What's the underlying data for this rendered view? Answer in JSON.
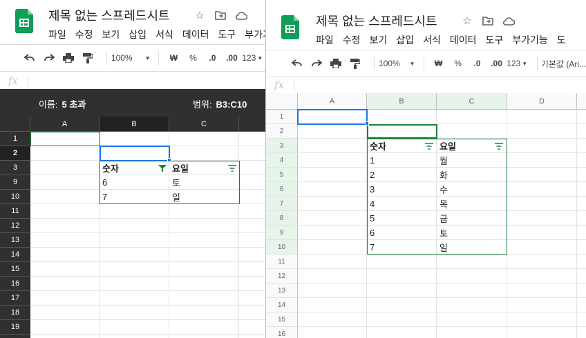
{
  "doc_title": "제목 없는 스프레드시트",
  "menu": [
    "파일",
    "수정",
    "보기",
    "삽입",
    "서식",
    "데이터",
    "도구",
    "부가기능",
    "도"
  ],
  "toolbar": {
    "zoom": "100%",
    "currency": "₩",
    "percent": "%",
    "dec_decrease": ".0",
    "dec_increase": ".00",
    "more_formats": "123",
    "font": "기본값 (Ari..."
  },
  "formula_bar": {
    "fx_label": "fx",
    "value": ""
  },
  "left_window": {
    "name_label": "이름:",
    "name_value": "5 초과",
    "range_label": "범위:",
    "range_value": "B3:C10",
    "columns": [
      "A",
      "B",
      "C"
    ],
    "rows": [
      "1",
      "2",
      "3",
      "9",
      "10",
      "11",
      "12",
      "13",
      "14",
      "15",
      "16",
      "17",
      "18",
      "19",
      "20"
    ],
    "headers": [
      "숫자",
      "요일"
    ],
    "data": [
      [
        "6",
        "토"
      ],
      [
        "7",
        "일"
      ]
    ]
  },
  "right_window": {
    "columns": [
      "A",
      "B",
      "C",
      "D"
    ],
    "rows": [
      "1",
      "2",
      "3",
      "4",
      "5",
      "6",
      "7",
      "8",
      "9",
      "10",
      "11",
      "12",
      "13",
      "14",
      "15",
      "16"
    ],
    "headers": [
      "숫자",
      "요일"
    ],
    "data": [
      [
        "1",
        "월"
      ],
      [
        "2",
        "화"
      ],
      [
        "3",
        "수"
      ],
      [
        "4",
        "목"
      ],
      [
        "5",
        "금"
      ],
      [
        "6",
        "토"
      ],
      [
        "7",
        "일"
      ]
    ]
  },
  "colors": {
    "sheets_green": "#0f9d58",
    "selection_blue": "#1a73e8",
    "filter_green": "#188038",
    "dark_header": "#303030"
  }
}
